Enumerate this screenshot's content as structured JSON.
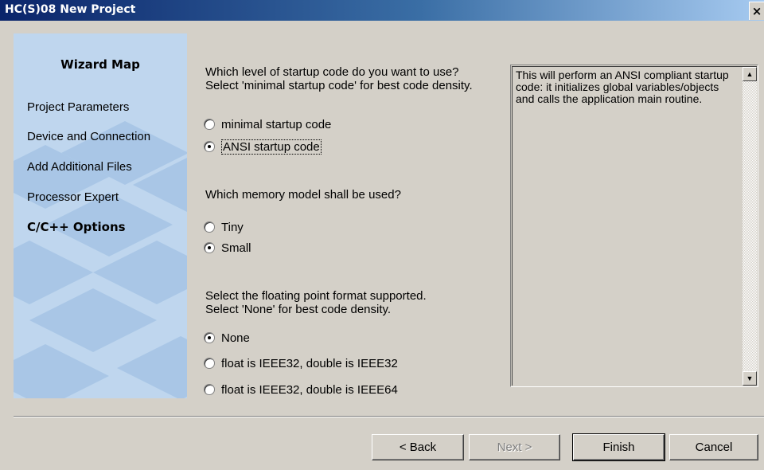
{
  "window": {
    "title": "HC(S)08 New Project",
    "close_glyph": "×"
  },
  "wizard_map": {
    "title": "Wizard Map",
    "items": [
      {
        "label": "Project Parameters",
        "active": false
      },
      {
        "label": "Device and Connection",
        "active": false
      },
      {
        "label": "Add Additional Files",
        "active": false
      },
      {
        "label": "Processor Expert",
        "active": false
      },
      {
        "label": "C/C++ Options",
        "active": true
      }
    ],
    "colors": {
      "panel": "#bfd6ee",
      "shape": "#a9c6e6"
    }
  },
  "startup": {
    "question_line1": "Which level of startup code do you want to use?",
    "question_line2": "Select 'minimal startup code' for best code density.",
    "options": [
      {
        "label": "minimal startup code",
        "checked": false
      },
      {
        "label": "ANSI startup code",
        "checked": true
      }
    ]
  },
  "memory": {
    "question": "Which memory model shall be used?",
    "options": [
      {
        "label": "Tiny",
        "checked": false
      },
      {
        "label": "Small",
        "checked": true
      }
    ]
  },
  "floating": {
    "question_line1": "Select the floating point format supported.",
    "question_line2": "Select 'None' for best code density.",
    "options": [
      {
        "label": "None",
        "checked": true
      },
      {
        "label": "float is IEEE32, double is IEEE32",
        "checked": false
      },
      {
        "label": "float is IEEE32, double is IEEE64",
        "checked": false
      }
    ]
  },
  "description": {
    "text": "This will perform an ANSI compliant startup code: it initializes global variables/objects and calls the application main routine.",
    "scroll_up_glyph": "▲",
    "scroll_down_glyph": "▼"
  },
  "buttons": {
    "back": "< Back",
    "next": "Next >",
    "finish": "Finish",
    "cancel": "Cancel"
  }
}
